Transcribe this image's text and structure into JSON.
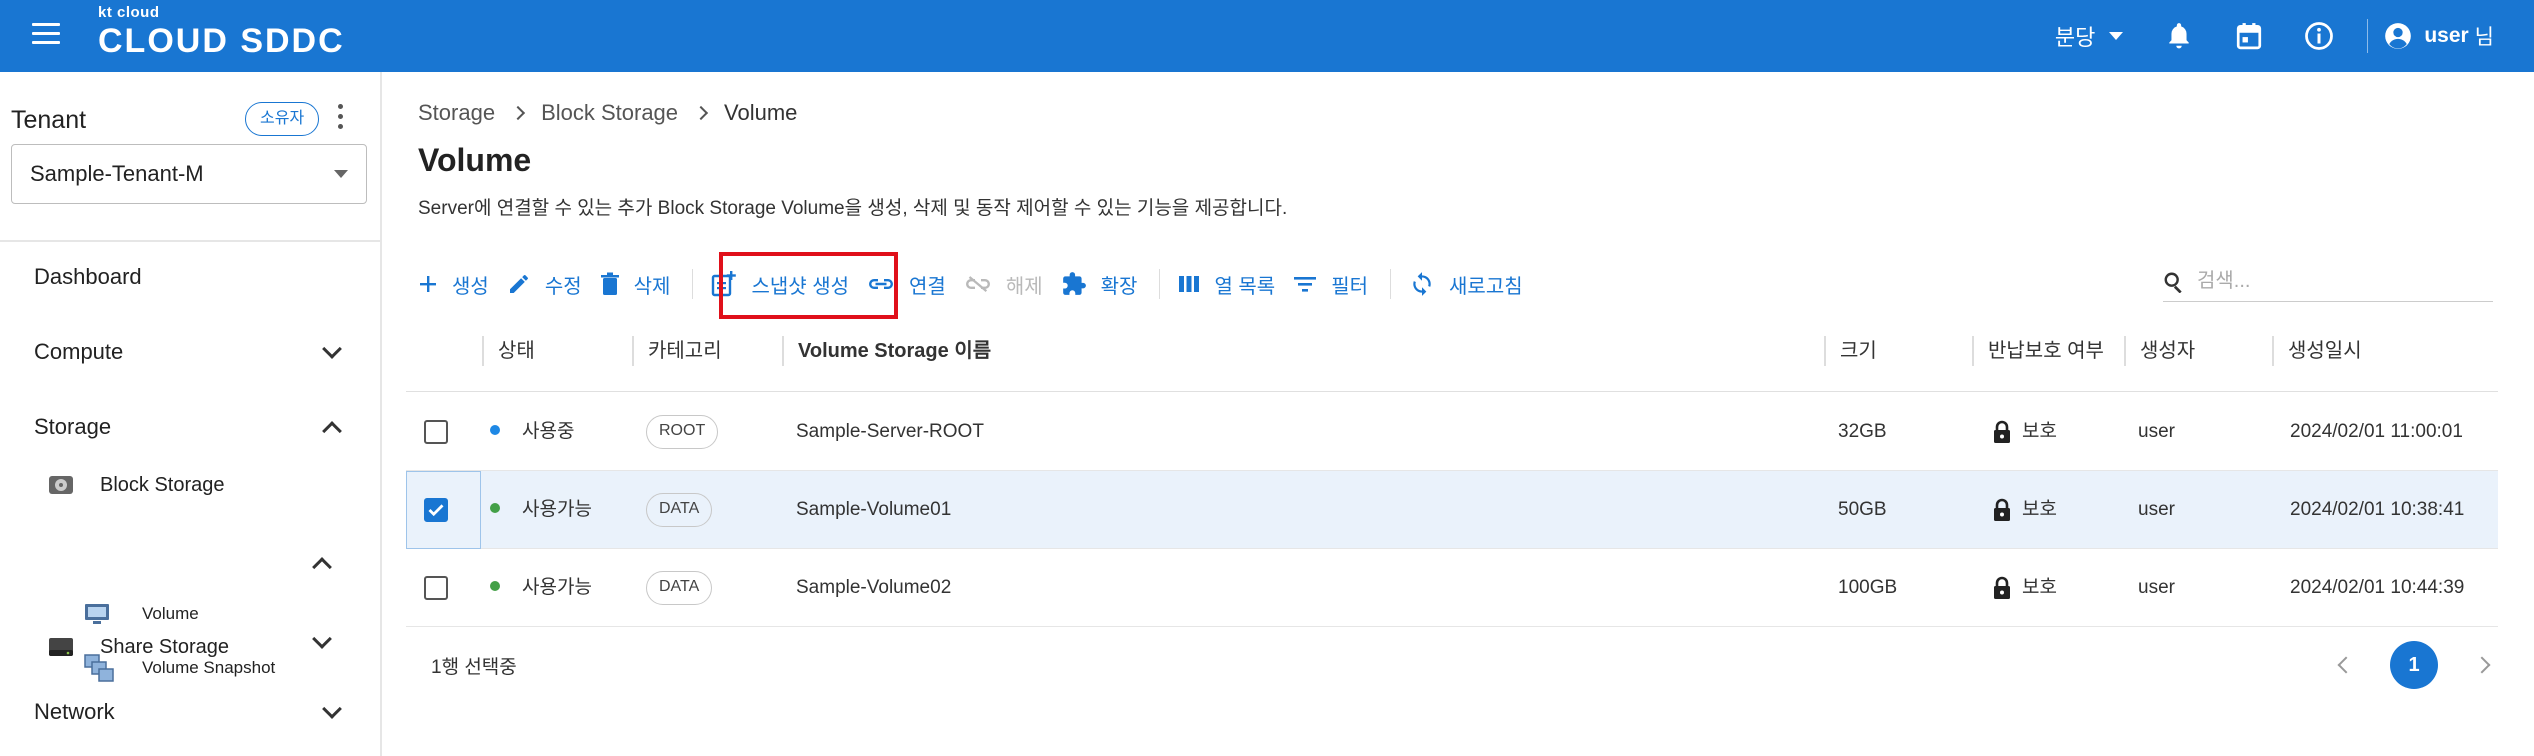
{
  "header": {
    "logo_small": "kt cloud",
    "logo_big": "CLOUD SDDC",
    "branch": "분당",
    "user_name": "user",
    "user_suffix": "님"
  },
  "sidebar": {
    "tenant_label": "Tenant",
    "owner_chip": "소유자",
    "tenant_value": "Sample-Tenant-M",
    "items": [
      {
        "label": "Dashboard"
      },
      {
        "label": "Compute",
        "chevron": "down"
      },
      {
        "label": "Storage",
        "chevron": "up"
      },
      {
        "label": "Block Storage",
        "chevron": "up"
      },
      {
        "label": "Volume"
      },
      {
        "label": "Volume Snapshot"
      },
      {
        "label": "Share Storage",
        "chevron": "down"
      },
      {
        "label": "Network",
        "chevron": "down"
      }
    ]
  },
  "breadcrumb": [
    "Storage",
    "Block Storage",
    "Volume"
  ],
  "page": {
    "title": "Volume",
    "description": "Server에 연결할 수 있는 추가 Block Storage Volume을 생성, 삭제 및 동작 제어할 수 있는 기능을 제공합니다."
  },
  "toolbar": {
    "create": "생성",
    "edit": "수정",
    "delete": "삭제",
    "snapshot": "스냅샷 생성",
    "attach": "연결",
    "detach": "해제",
    "extend": "확장",
    "columns": "열 목록",
    "filter": "필터",
    "refresh": "새로고침",
    "search_placeholder": "검색..."
  },
  "table": {
    "headers": [
      "상태",
      "카테고리",
      "Volume Storage 이름",
      "크기",
      "반납보호 여부",
      "생성자",
      "생성일시"
    ],
    "rows": [
      {
        "selected": false,
        "status": "사용중",
        "status_color": "#1e88e5",
        "category": "ROOT",
        "name": "Sample-Server-ROOT",
        "size": "32GB",
        "protect": "보호",
        "creator": "user",
        "created": "2024/02/01 11:00:01"
      },
      {
        "selected": true,
        "status": "사용가능",
        "status_color": "#43a047",
        "category": "DATA",
        "name": "Sample-Volume01",
        "size": "50GB",
        "protect": "보호",
        "creator": "user",
        "created": "2024/02/01 10:38:41"
      },
      {
        "selected": false,
        "status": "사용가능",
        "status_color": "#43a047",
        "category": "DATA",
        "name": "Sample-Volume02",
        "size": "100GB",
        "protect": "보호",
        "creator": "user",
        "created": "2024/02/01 10:44:39"
      }
    ]
  },
  "footer": {
    "selection_text": "1행 선택중",
    "current_page": "1"
  },
  "colors": {
    "primary": "#1976d2",
    "highlight_box": "#e0101a"
  }
}
